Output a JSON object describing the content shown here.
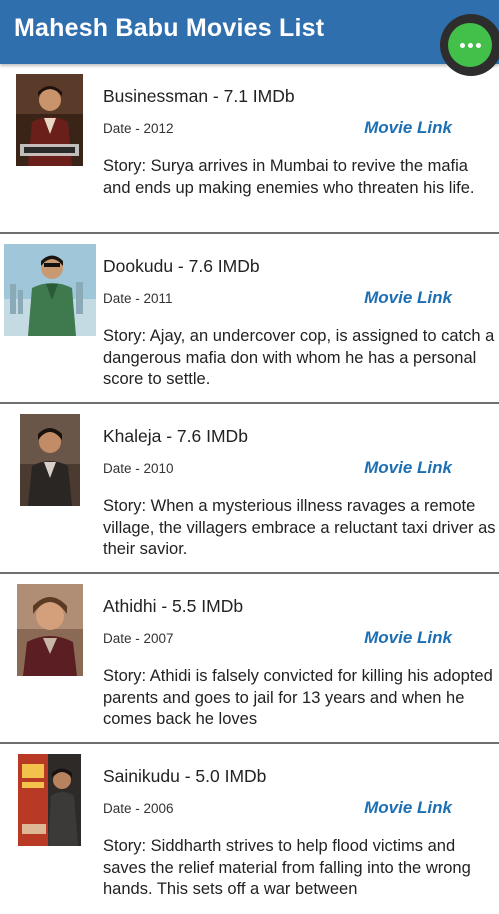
{
  "app_bar": {
    "title": "Mahesh Babu Movies List",
    "color": "#2f6fae",
    "fab_icon": "more-horizontal-icon",
    "fab_color": "#43c04a"
  },
  "movies": [
    {
      "title": "Businessman - 7.1 IMDb",
      "date": "Date - 2012",
      "link": "Movie Link",
      "story": "Story: Surya arrives in Mumbai to revive the mafia and ends up making enemies who threaten his life."
    },
    {
      "title": "Dookudu - 7.6 IMDb",
      "date": "Date - 2011",
      "link": "Movie Link",
      "story": "Story: Ajay, an undercover cop, is assigned to catch a dangerous mafia don with whom he has a personal score to settle."
    },
    {
      "title": "Khaleja - 7.6 IMDb",
      "date": "Date - 2010",
      "link": "Movie Link",
      "story": "Story: When a mysterious illness ravages a remote village, the villagers embrace a reluctant taxi driver as their savior."
    },
    {
      "title": "Athidhi - 5.5 IMDb",
      "date": "Date - 2007",
      "link": "Movie Link",
      "story": "Story: Athidi is falsely convicted for killing his adopted parents and goes to jail for 13 years and when he comes back he loves"
    },
    {
      "title": "Sainikudu - 5.0 IMDb",
      "date": "Date - 2006",
      "link": "Movie Link",
      "story": "Story: Siddharth strives to help flood victims and saves the relief material from falling into the wrong hands. This sets off a war between"
    }
  ]
}
